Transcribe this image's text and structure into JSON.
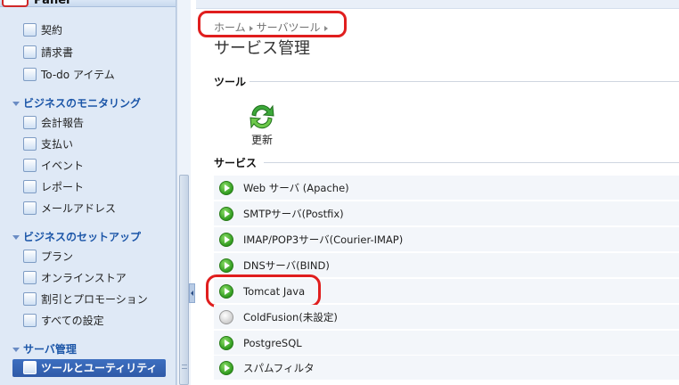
{
  "sidebar": {
    "panel_title": "Panel",
    "top_items": [
      {
        "label": "契約",
        "icon": "contract-icon"
      },
      {
        "label": "請求書",
        "icon": "invoice-icon"
      },
      {
        "label": "To-do アイテム",
        "icon": "todo-icon"
      }
    ],
    "groups": [
      {
        "title": "ビジネスのモニタリング",
        "items": [
          {
            "label": "会計報告",
            "icon": "accounting-icon"
          },
          {
            "label": "支払い",
            "icon": "payment-icon"
          },
          {
            "label": "イベント",
            "icon": "calendar-icon"
          },
          {
            "label": "レポート",
            "icon": "report-icon"
          },
          {
            "label": "メールアドレス",
            "icon": "mail-icon"
          }
        ]
      },
      {
        "title": "ビジネスのセットアップ",
        "items": [
          {
            "label": "プラン",
            "icon": "plan-icon"
          },
          {
            "label": "オンラインストア",
            "icon": "store-icon"
          },
          {
            "label": "割引とプロモーション",
            "icon": "discount-icon"
          },
          {
            "label": "すべての設定",
            "icon": "settings-icon"
          }
        ]
      },
      {
        "title": "サーバ管理",
        "items": [
          {
            "label": "ツールとユーティリティ",
            "icon": "tools-icon",
            "selected": true
          }
        ]
      }
    ]
  },
  "breadcrumb": [
    "ホーム",
    "サーバツール"
  ],
  "page_title": "サービス管理",
  "tools_section": {
    "title": "ツール",
    "tools": [
      {
        "label": "更新",
        "icon": "refresh-icon"
      }
    ]
  },
  "services_section": {
    "title": "サービス",
    "services": [
      {
        "name": "Web サーバ (Apache)",
        "status": "running"
      },
      {
        "name": "SMTPサーバ(Postfix)",
        "status": "running"
      },
      {
        "name": "IMAP/POP3サーバ(Courier-IMAP)",
        "status": "running"
      },
      {
        "name": "DNSサーバ(BIND)",
        "status": "running"
      },
      {
        "name": "Tomcat Java",
        "status": "running"
      },
      {
        "name": "ColdFusion(未設定)",
        "status": "stopped"
      },
      {
        "name": "PostgreSQL",
        "status": "running"
      },
      {
        "name": "スパムフィルタ",
        "status": "running"
      }
    ]
  },
  "colors": {
    "annotation": "#e01e1e",
    "sidebar_bg": "#dfe9f6",
    "group_title": "#1c56a8",
    "selected_item": "#2f5aa8",
    "running": "#2f9a1e",
    "stopped": "#a8a8a8"
  }
}
